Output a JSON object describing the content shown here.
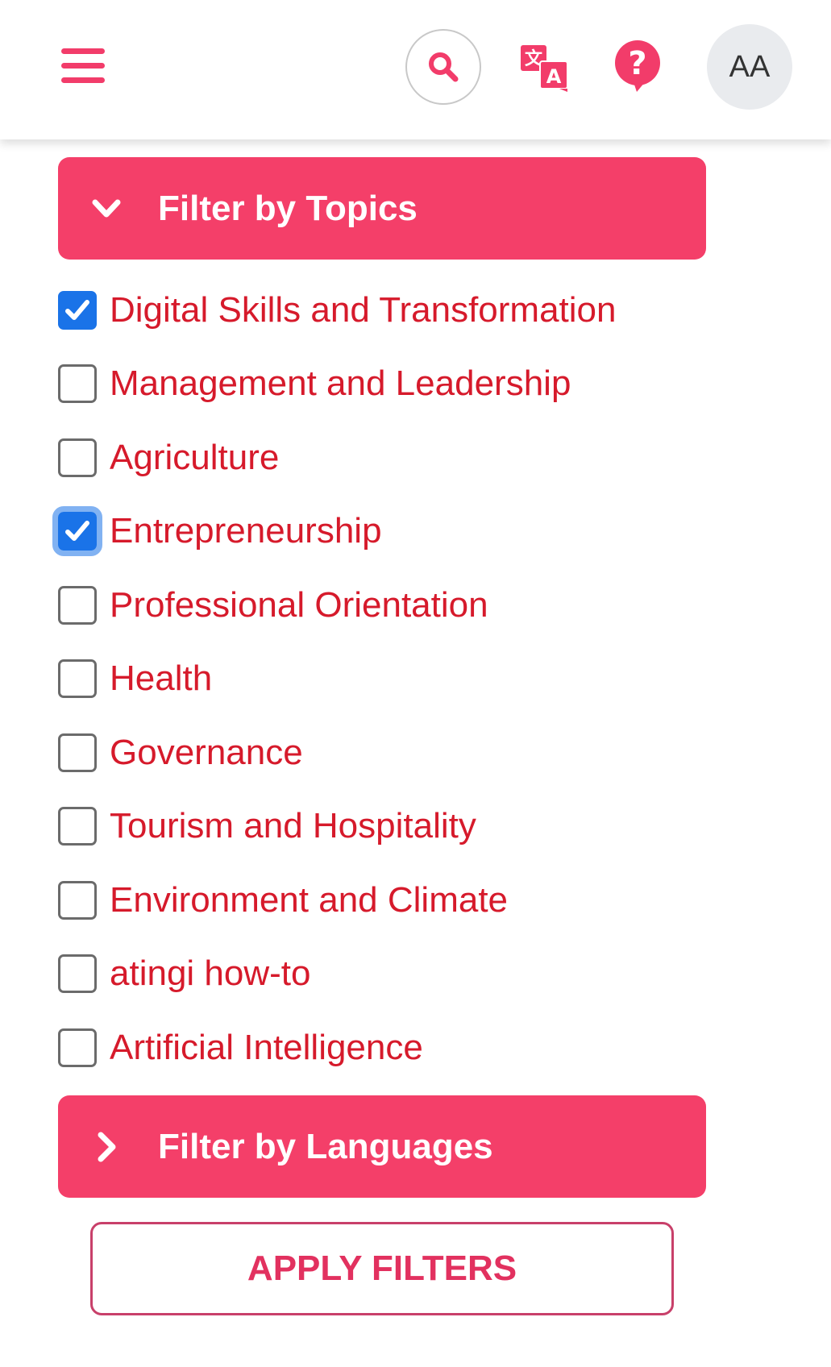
{
  "colors": {
    "accent": "#f43f69",
    "topic_text": "#d61a2b",
    "checkbox_checked": "#1a73e8",
    "apply_text": "#e2315f"
  },
  "header": {
    "menu_icon": "hamburger-menu-icon",
    "search_icon": "search-icon",
    "translate_icon": "translate-icon",
    "help_icon": "help-icon",
    "font_size_label": "AA"
  },
  "filters": {
    "topics": {
      "title": "Filter by Topics",
      "expanded": true,
      "items": [
        {
          "label": "Digital Skills and Transformation",
          "checked": true
        },
        {
          "label": "Management and Leadership",
          "checked": false
        },
        {
          "label": "Agriculture",
          "checked": false
        },
        {
          "label": "Entrepreneurship",
          "checked": true,
          "focused": true
        },
        {
          "label": "Professional Orientation",
          "checked": false
        },
        {
          "label": "Health",
          "checked": false
        },
        {
          "label": "Governance",
          "checked": false
        },
        {
          "label": "Tourism and Hospitality",
          "checked": false
        },
        {
          "label": "Environment and Climate",
          "checked": false
        },
        {
          "label": "atingi how-to",
          "checked": false
        },
        {
          "label": "Artificial Intelligence",
          "checked": false
        }
      ]
    },
    "languages": {
      "title": "Filter by Languages",
      "expanded": false
    },
    "apply_label": "APPLY FILTERS"
  }
}
